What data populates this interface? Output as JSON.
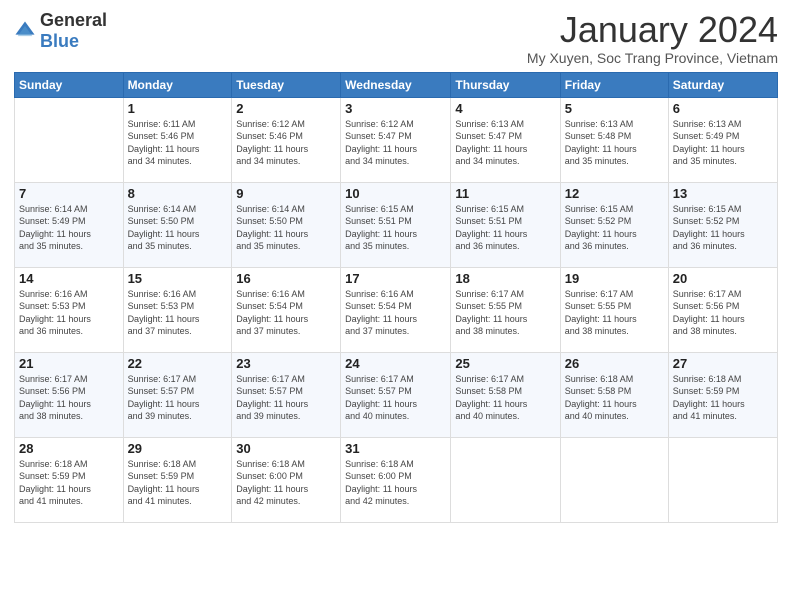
{
  "logo": {
    "general": "General",
    "blue": "Blue"
  },
  "header": {
    "month_title": "January 2024",
    "location": "My Xuyen, Soc Trang Province, Vietnam"
  },
  "weekdays": [
    "Sunday",
    "Monday",
    "Tuesday",
    "Wednesday",
    "Thursday",
    "Friday",
    "Saturday"
  ],
  "weeks": [
    [
      {
        "day": "",
        "info": ""
      },
      {
        "day": "1",
        "info": "Sunrise: 6:11 AM\nSunset: 5:46 PM\nDaylight: 11 hours\nand 34 minutes."
      },
      {
        "day": "2",
        "info": "Sunrise: 6:12 AM\nSunset: 5:46 PM\nDaylight: 11 hours\nand 34 minutes."
      },
      {
        "day": "3",
        "info": "Sunrise: 6:12 AM\nSunset: 5:47 PM\nDaylight: 11 hours\nand 34 minutes."
      },
      {
        "day": "4",
        "info": "Sunrise: 6:13 AM\nSunset: 5:47 PM\nDaylight: 11 hours\nand 34 minutes."
      },
      {
        "day": "5",
        "info": "Sunrise: 6:13 AM\nSunset: 5:48 PM\nDaylight: 11 hours\nand 35 minutes."
      },
      {
        "day": "6",
        "info": "Sunrise: 6:13 AM\nSunset: 5:49 PM\nDaylight: 11 hours\nand 35 minutes."
      }
    ],
    [
      {
        "day": "7",
        "info": "Sunrise: 6:14 AM\nSunset: 5:49 PM\nDaylight: 11 hours\nand 35 minutes."
      },
      {
        "day": "8",
        "info": "Sunrise: 6:14 AM\nSunset: 5:50 PM\nDaylight: 11 hours\nand 35 minutes."
      },
      {
        "day": "9",
        "info": "Sunrise: 6:14 AM\nSunset: 5:50 PM\nDaylight: 11 hours\nand 35 minutes."
      },
      {
        "day": "10",
        "info": "Sunrise: 6:15 AM\nSunset: 5:51 PM\nDaylight: 11 hours\nand 35 minutes."
      },
      {
        "day": "11",
        "info": "Sunrise: 6:15 AM\nSunset: 5:51 PM\nDaylight: 11 hours\nand 36 minutes."
      },
      {
        "day": "12",
        "info": "Sunrise: 6:15 AM\nSunset: 5:52 PM\nDaylight: 11 hours\nand 36 minutes."
      },
      {
        "day": "13",
        "info": "Sunrise: 6:15 AM\nSunset: 5:52 PM\nDaylight: 11 hours\nand 36 minutes."
      }
    ],
    [
      {
        "day": "14",
        "info": "Sunrise: 6:16 AM\nSunset: 5:53 PM\nDaylight: 11 hours\nand 36 minutes."
      },
      {
        "day": "15",
        "info": "Sunrise: 6:16 AM\nSunset: 5:53 PM\nDaylight: 11 hours\nand 37 minutes."
      },
      {
        "day": "16",
        "info": "Sunrise: 6:16 AM\nSunset: 5:54 PM\nDaylight: 11 hours\nand 37 minutes."
      },
      {
        "day": "17",
        "info": "Sunrise: 6:16 AM\nSunset: 5:54 PM\nDaylight: 11 hours\nand 37 minutes."
      },
      {
        "day": "18",
        "info": "Sunrise: 6:17 AM\nSunset: 5:55 PM\nDaylight: 11 hours\nand 38 minutes."
      },
      {
        "day": "19",
        "info": "Sunrise: 6:17 AM\nSunset: 5:55 PM\nDaylight: 11 hours\nand 38 minutes."
      },
      {
        "day": "20",
        "info": "Sunrise: 6:17 AM\nSunset: 5:56 PM\nDaylight: 11 hours\nand 38 minutes."
      }
    ],
    [
      {
        "day": "21",
        "info": "Sunrise: 6:17 AM\nSunset: 5:56 PM\nDaylight: 11 hours\nand 38 minutes."
      },
      {
        "day": "22",
        "info": "Sunrise: 6:17 AM\nSunset: 5:57 PM\nDaylight: 11 hours\nand 39 minutes."
      },
      {
        "day": "23",
        "info": "Sunrise: 6:17 AM\nSunset: 5:57 PM\nDaylight: 11 hours\nand 39 minutes."
      },
      {
        "day": "24",
        "info": "Sunrise: 6:17 AM\nSunset: 5:57 PM\nDaylight: 11 hours\nand 40 minutes."
      },
      {
        "day": "25",
        "info": "Sunrise: 6:17 AM\nSunset: 5:58 PM\nDaylight: 11 hours\nand 40 minutes."
      },
      {
        "day": "26",
        "info": "Sunrise: 6:18 AM\nSunset: 5:58 PM\nDaylight: 11 hours\nand 40 minutes."
      },
      {
        "day": "27",
        "info": "Sunrise: 6:18 AM\nSunset: 5:59 PM\nDaylight: 11 hours\nand 41 minutes."
      }
    ],
    [
      {
        "day": "28",
        "info": "Sunrise: 6:18 AM\nSunset: 5:59 PM\nDaylight: 11 hours\nand 41 minutes."
      },
      {
        "day": "29",
        "info": "Sunrise: 6:18 AM\nSunset: 5:59 PM\nDaylight: 11 hours\nand 41 minutes."
      },
      {
        "day": "30",
        "info": "Sunrise: 6:18 AM\nSunset: 6:00 PM\nDaylight: 11 hours\nand 42 minutes."
      },
      {
        "day": "31",
        "info": "Sunrise: 6:18 AM\nSunset: 6:00 PM\nDaylight: 11 hours\nand 42 minutes."
      },
      {
        "day": "",
        "info": ""
      },
      {
        "day": "",
        "info": ""
      },
      {
        "day": "",
        "info": ""
      }
    ]
  ]
}
